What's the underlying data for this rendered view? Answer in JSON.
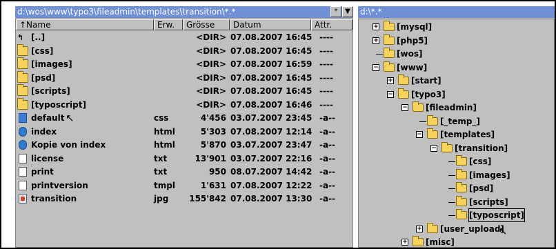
{
  "left_pane": {
    "path": "d:\\wos\\www\\typo3\\fileadmin\\templates\\transition\\*.*",
    "star_button": "*",
    "dropdown_button": "▼",
    "columns": {
      "name": "↑Name",
      "ext": "Erw.",
      "size": "Grösse",
      "date": "Datum",
      "attr": "Attr."
    },
    "rows": [
      {
        "name": "[..]",
        "ext": "",
        "size": "<DIR>",
        "date": "07.08.2007 16:45",
        "attr": "----",
        "icon": "up-icon"
      },
      {
        "name": "[css]",
        "ext": "",
        "size": "<DIR>",
        "date": "07.08.2007 16:45",
        "attr": "----",
        "icon": "folder-icon"
      },
      {
        "name": "[images]",
        "ext": "",
        "size": "<DIR>",
        "date": "07.08.2007 16:59",
        "attr": "----",
        "icon": "folder-icon"
      },
      {
        "name": "[psd]",
        "ext": "",
        "size": "<DIR>",
        "date": "07.08.2007 16:45",
        "attr": "----",
        "icon": "folder-icon"
      },
      {
        "name": "[scripts]",
        "ext": "",
        "size": "<DIR>",
        "date": "07.08.2007 16:45",
        "attr": "----",
        "icon": "folder-icon"
      },
      {
        "name": "[typoscript]",
        "ext": "",
        "size": "<DIR>",
        "date": "07.08.2007 16:46",
        "attr": "----",
        "icon": "folder-icon"
      },
      {
        "name": "default",
        "ext": "css",
        "size": "4'456",
        "date": "03.07.2007 23:45",
        "attr": "-a--",
        "icon": "css-file-icon"
      },
      {
        "name": "index",
        "ext": "html",
        "size": "5'303",
        "date": "07.08.2007 12:14",
        "attr": "-a--",
        "icon": "html-file-icon"
      },
      {
        "name": "Kopie von index",
        "ext": "html",
        "size": "5'870",
        "date": "03.07.2007 23:47",
        "attr": "-a--",
        "icon": "html-file-icon"
      },
      {
        "name": "license",
        "ext": "txt",
        "size": "13'901",
        "date": "03.07.2007 22:16",
        "attr": "-a--",
        "icon": "text-file-icon"
      },
      {
        "name": "print",
        "ext": "txt",
        "size": "950",
        "date": "08.07.2007 14:42",
        "attr": "-a--",
        "icon": "text-file-icon"
      },
      {
        "name": "printversion",
        "ext": "tmpl",
        "size": "1'631",
        "date": "07.08.2007 12:22",
        "attr": "-a--",
        "icon": "blank-file-icon"
      },
      {
        "name": "transition",
        "ext": "jpg",
        "size": "155'842",
        "date": "07.08.2007 13:30",
        "attr": "-a--",
        "icon": "image-file-icon"
      }
    ]
  },
  "right_pane": {
    "path": "d:\\*.*",
    "tree": [
      {
        "label": "[mysql]",
        "toggle": "+"
      },
      {
        "label": "[php5]",
        "toggle": "+"
      },
      {
        "label": "[wos]",
        "toggle": ""
      },
      {
        "label": "[www]",
        "toggle": "−"
      },
      {
        "label": "[start]",
        "toggle": "+"
      },
      {
        "label": "[typo3]",
        "toggle": "−"
      },
      {
        "label": "[fileadmin]",
        "toggle": "−"
      },
      {
        "label": "[_temp_]",
        "toggle": ""
      },
      {
        "label": "[templates]",
        "toggle": "−"
      },
      {
        "label": "[transition]",
        "toggle": "−"
      },
      {
        "label": "[css]",
        "toggle": ""
      },
      {
        "label": "[images]",
        "toggle": ""
      },
      {
        "label": "[psd]",
        "toggle": ""
      },
      {
        "label": "[scripts]",
        "toggle": ""
      },
      {
        "label": "[typoscript]",
        "toggle": ""
      },
      {
        "label": "[user_upload]",
        "toggle": "+"
      },
      {
        "label": "[misc]",
        "toggle": "+"
      }
    ]
  }
}
